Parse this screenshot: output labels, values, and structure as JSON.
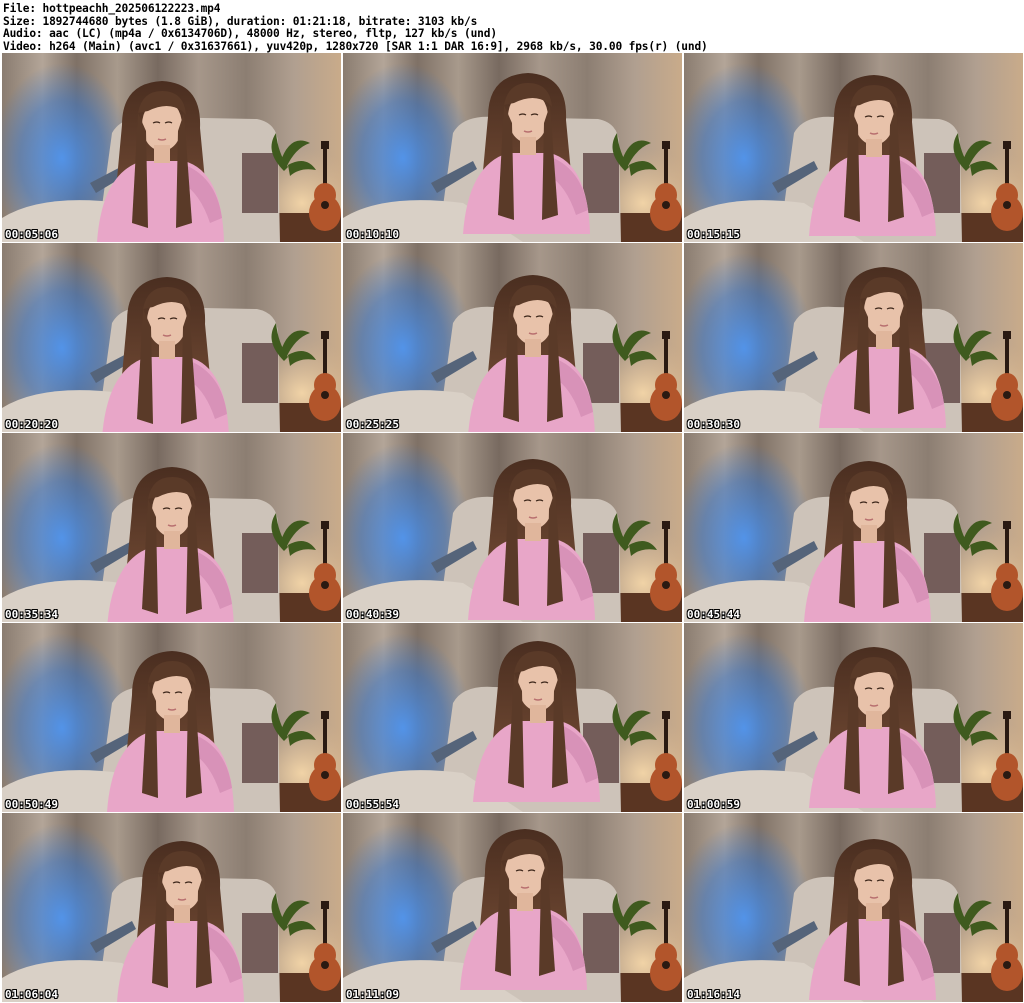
{
  "header": {
    "lines": [
      "File: hottpeachh_202506122223.mp4",
      "Size: 1892744680 bytes (1.8 GiB), duration: 01:21:18, bitrate: 3103 kb/s",
      "Audio: aac (LC) (mp4a / 0x6134706D), 48000 Hz, stereo, fltp, 127 kb/s (und)",
      "Video: h264 (Main) (avc1 / 0x31637661), yuv420p, 1280x720 [SAR 1:1 DAR 16:9], 2968 kb/s, 30.00 fps(r) (und)"
    ]
  },
  "thumbnails": [
    {
      "timestamp": "00:05:06"
    },
    {
      "timestamp": "00:10:10"
    },
    {
      "timestamp": "00:15:15"
    },
    {
      "timestamp": "00:20:20"
    },
    {
      "timestamp": "00:25:25"
    },
    {
      "timestamp": "00:30:30"
    },
    {
      "timestamp": "00:35:34"
    },
    {
      "timestamp": "00:40:39"
    },
    {
      "timestamp": "00:45:44"
    },
    {
      "timestamp": "00:50:49"
    },
    {
      "timestamp": "00:55:54"
    },
    {
      "timestamp": "01:00:59"
    },
    {
      "timestamp": "01:06:04"
    },
    {
      "timestamp": "01:11:09"
    },
    {
      "timestamp": "01:16:14"
    }
  ],
  "colors": {
    "curtain_light": "#a99a8c",
    "curtain_dark": "#6f6258",
    "blue_glow": "#3d7fd6",
    "wall_warm": "#d8b48c",
    "hair": "#5a3a28",
    "skin": "#e8c0a8",
    "shirt": "#e8a6c8",
    "sofa": "#c8bfb6",
    "floor": "#5a3522",
    "guitar": "#b2552b"
  }
}
